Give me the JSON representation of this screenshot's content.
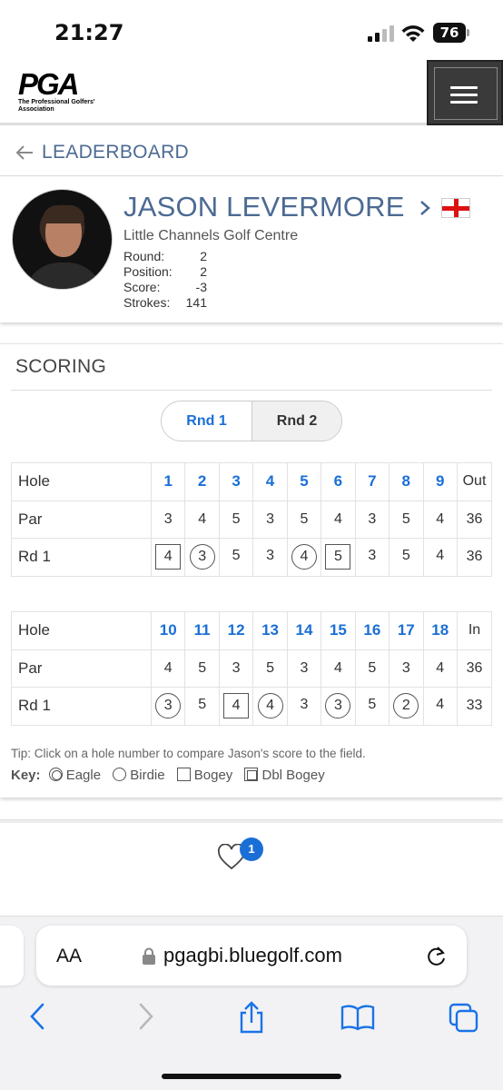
{
  "status_bar": {
    "time": "21:27",
    "battery": "76"
  },
  "header": {
    "logo_text": "PGA",
    "logo_subtitle": "The Professional Golfers' Association",
    "menu_icon": "hamburger-icon"
  },
  "nav": {
    "back_label": "LEADERBOARD"
  },
  "player": {
    "name": "JASON LEVERMORE",
    "club": "Little Channels Golf Centre",
    "flag": "england-flag",
    "stats": [
      {
        "label": "Round:",
        "value": "2"
      },
      {
        "label": "Position:",
        "value": "2"
      },
      {
        "label": "Score:",
        "value": "-3"
      },
      {
        "label": "Strokes:",
        "value": "141"
      }
    ]
  },
  "scoring": {
    "title": "SCORING",
    "round_tabs": [
      "Rnd 1",
      "Rnd 2"
    ],
    "active_tab": "Rnd 1",
    "front": {
      "hole_label": "Hole",
      "holes": [
        "1",
        "2",
        "3",
        "4",
        "5",
        "6",
        "7",
        "8",
        "9"
      ],
      "total_label": "Out",
      "par_label": "Par",
      "par": [
        "3",
        "4",
        "5",
        "3",
        "5",
        "4",
        "3",
        "5",
        "4"
      ],
      "par_total": "36",
      "round_label": "Rd 1",
      "scores": [
        "4",
        "3",
        "5",
        "3",
        "4",
        "5",
        "3",
        "5",
        "4"
      ],
      "score_types": [
        "bogey",
        "birdie",
        "par",
        "par",
        "birdie",
        "bogey",
        "par",
        "par",
        "par"
      ],
      "score_total": "36"
    },
    "back": {
      "hole_label": "Hole",
      "holes": [
        "10",
        "11",
        "12",
        "13",
        "14",
        "15",
        "16",
        "17",
        "18"
      ],
      "total_label": "In",
      "par_label": "Par",
      "par": [
        "4",
        "5",
        "3",
        "5",
        "3",
        "4",
        "5",
        "3",
        "4"
      ],
      "par_total": "36",
      "round_label": "Rd 1",
      "scores": [
        "3",
        "5",
        "4",
        "4",
        "3",
        "3",
        "5",
        "2",
        "4"
      ],
      "score_types": [
        "birdie",
        "par",
        "bogey",
        "birdie",
        "par",
        "birdie",
        "par",
        "birdie",
        "par"
      ],
      "score_total": "33"
    },
    "tip": "Tip: Click on a hole number to compare Jason's score to the field.",
    "key_label": "Key:",
    "key_items": [
      {
        "symbol": "eagle",
        "label": "Eagle"
      },
      {
        "symbol": "birdie",
        "label": "Birdie"
      },
      {
        "symbol": "bogey",
        "label": "Bogey"
      },
      {
        "symbol": "dbl",
        "label": "Dbl Bogey"
      }
    ]
  },
  "footer": {
    "like_count": "1",
    "like_icon": "heart-icon"
  },
  "browser": {
    "text_size": "AA",
    "url": "pgagbi.bluegolf.com",
    "toolbar_icons": [
      "back-icon",
      "forward-icon",
      "share-icon",
      "bookmarks-icon",
      "tabs-icon"
    ]
  },
  "colors": {
    "brand_blue": "#4c6a93",
    "link_blue": "#1a6fd6"
  }
}
